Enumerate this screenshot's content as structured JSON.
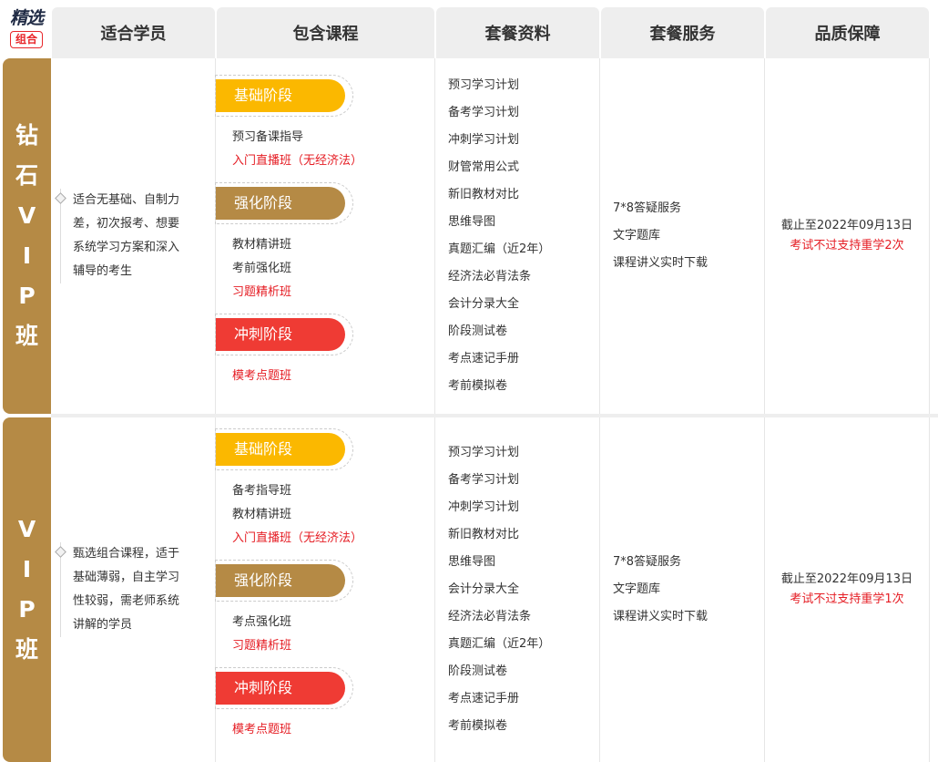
{
  "logo": {
    "line1": "精选",
    "line2": "组合"
  },
  "header": {
    "students": "适合学员",
    "courses": "包含课程",
    "materials": "套餐资料",
    "services": "套餐服务",
    "guarantee": "品质保障"
  },
  "rows": [
    {
      "title_chars": [
        "钻",
        "石",
        "V",
        "I",
        "P",
        "班"
      ],
      "student_text": "适合无基础、自制力差，初次报考、想要系统学习方案和深入辅导的考生",
      "stages": [
        {
          "label": "基础阶段",
          "courses": [
            {
              "text": "预习备课指导",
              "red": false
            },
            {
              "text": "入门直播班（无经济法）",
              "red": true
            }
          ]
        },
        {
          "label": "强化阶段",
          "courses": [
            {
              "text": "教材精讲班",
              "red": false
            },
            {
              "text": "考前强化班",
              "red": false
            },
            {
              "text": "习题精析班",
              "red": true
            }
          ]
        },
        {
          "label": "冲刺阶段",
          "courses": [
            {
              "text": "模考点题班",
              "red": true
            }
          ]
        }
      ],
      "materials": [
        "预习学习计划",
        "备考学习计划",
        "冲刺学习计划",
        "财管常用公式",
        "新旧教材对比",
        "思维导图",
        "真题汇编（近2年）",
        "经济法必背法条",
        "会计分录大全",
        "阶段测试卷",
        "考点速记手册",
        "考前模拟卷"
      ],
      "services": [
        "7*8答疑服务",
        "文字题库",
        "课程讲义实时下载"
      ],
      "guarantee": {
        "line1": "截止至2022年09月13日",
        "line2": "考试不过支持重学2次"
      }
    },
    {
      "title_chars": [
        "V",
        "I",
        "P",
        "班"
      ],
      "student_text": "甄选组合课程，适于基础薄弱，自主学习性较弱，需老师系统讲解的学员",
      "stages": [
        {
          "label": "基础阶段",
          "courses": [
            {
              "text": "备考指导班",
              "red": false
            },
            {
              "text": "教材精讲班",
              "red": false
            },
            {
              "text": "入门直播班（无经济法）",
              "red": true
            }
          ]
        },
        {
          "label": "强化阶段",
          "courses": [
            {
              "text": "考点强化班",
              "red": false
            },
            {
              "text": "习题精析班",
              "red": true
            }
          ]
        },
        {
          "label": "冲刺阶段",
          "courses": [
            {
              "text": "模考点题班",
              "red": true
            }
          ]
        }
      ],
      "materials": [
        "预习学习计划",
        "备考学习计划",
        "冲刺学习计划",
        "新旧教材对比",
        "思维导图",
        "会计分录大全",
        "经济法必背法条",
        "真题汇编（近2年）",
        "阶段测试卷",
        "考点速记手册",
        "考前模拟卷"
      ],
      "services": [
        "7*8答疑服务",
        "文字题库",
        "课程讲义实时下载"
      ],
      "guarantee": {
        "line1": "截止至2022年09月13日",
        "line2": "考试不过支持重学1次"
      }
    }
  ]
}
